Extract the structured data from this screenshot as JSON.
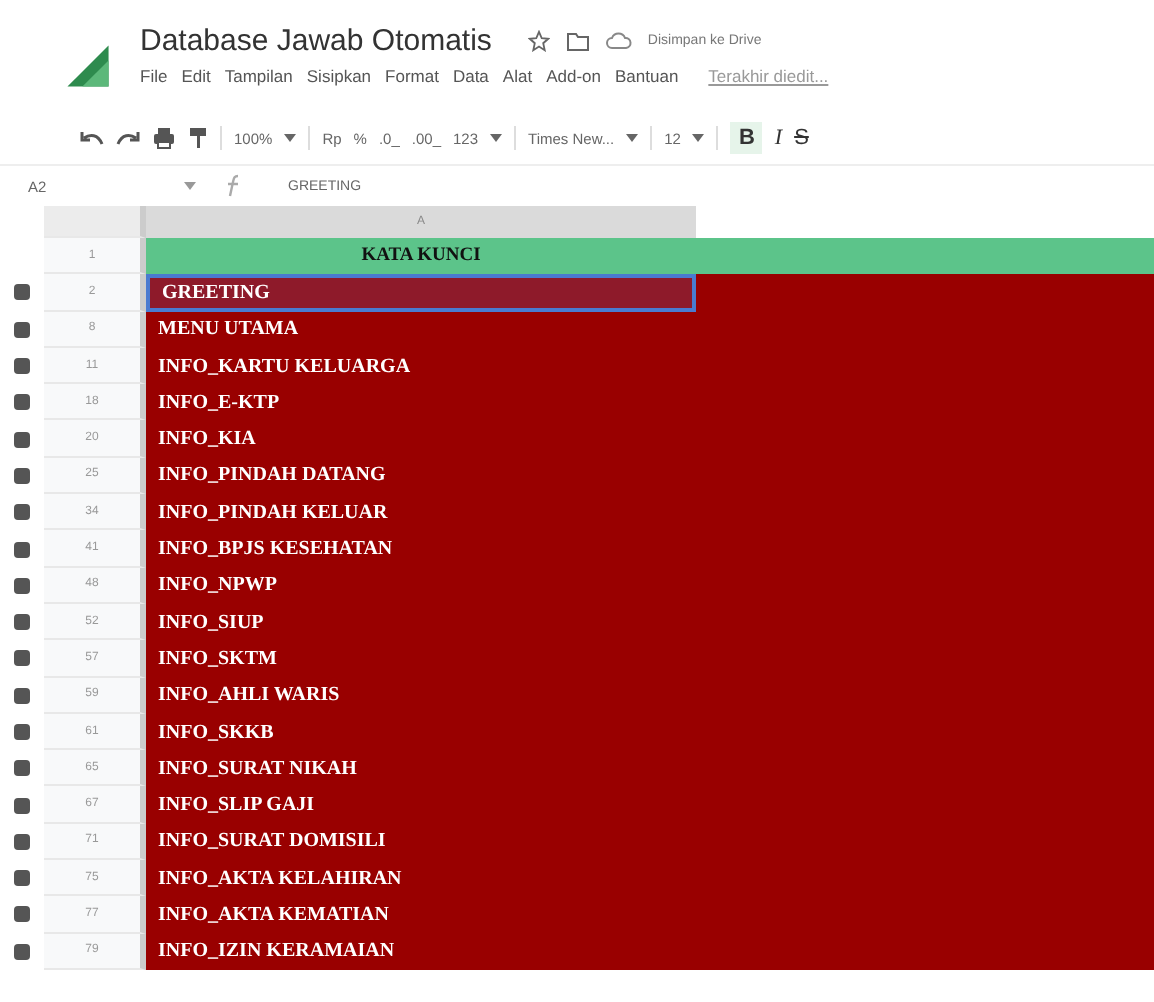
{
  "document": {
    "title": "Database Jawab Otomatis",
    "save_status": "Disimpan ke Drive",
    "last_edit": "Terakhir diedit..."
  },
  "menu": [
    "File",
    "Edit",
    "Tampilan",
    "Sisipkan",
    "Format",
    "Data",
    "Alat",
    "Add-on",
    "Bantuan"
  ],
  "toolbar": {
    "zoom": "100%",
    "currency": "Rp",
    "percent": "%",
    "decrease_decimals": ".0_",
    "increase_decimals": ".00_",
    "more_formats": "123",
    "font": "Times New...",
    "font_size": "12",
    "bold": "B",
    "italic": "I",
    "strikethrough": "S"
  },
  "formula_bar": {
    "cell": "A2",
    "value": "GREETING"
  },
  "columns": [
    "A"
  ],
  "header_row": {
    "number": "1",
    "text": "KATA KUNCI"
  },
  "rows": [
    {
      "number": "2",
      "text": "GREETING",
      "selected": true
    },
    {
      "number": "8",
      "text": "MENU UTAMA",
      "selected": false
    },
    {
      "number": "11",
      "text": "INFO_KARTU KELUARGA",
      "selected": false
    },
    {
      "number": "18",
      "text": "INFO_E-KTP",
      "selected": false
    },
    {
      "number": "20",
      "text": "INFO_KIA",
      "selected": false
    },
    {
      "number": "25",
      "text": "INFO_PINDAH DATANG",
      "selected": false
    },
    {
      "number": "34",
      "text": "INFO_PINDAH KELUAR",
      "selected": false
    },
    {
      "number": "41",
      "text": "INFO_BPJS KESEHATAN",
      "selected": false
    },
    {
      "number": "48",
      "text": "INFO_NPWP",
      "selected": false
    },
    {
      "number": "52",
      "text": "INFO_SIUP",
      "selected": false
    },
    {
      "number": "57",
      "text": "INFO_SKTM",
      "selected": false
    },
    {
      "number": "59",
      "text": "INFO_AHLI WARIS",
      "selected": false
    },
    {
      "number": "61",
      "text": "INFO_SKKB",
      "selected": false
    },
    {
      "number": "65",
      "text": "INFO_SURAT NIKAH",
      "selected": false
    },
    {
      "number": "67",
      "text": "INFO_SLIP GAJI",
      "selected": false
    },
    {
      "number": "71",
      "text": "INFO_SURAT DOMISILI",
      "selected": false
    },
    {
      "number": "75",
      "text": "INFO_AKTA KELAHIRAN",
      "selected": false
    },
    {
      "number": "77",
      "text": "INFO_AKTA KEMATIAN",
      "selected": false
    },
    {
      "number": "79",
      "text": "INFO_IZIN KERAMAIAN",
      "selected": false
    }
  ]
}
